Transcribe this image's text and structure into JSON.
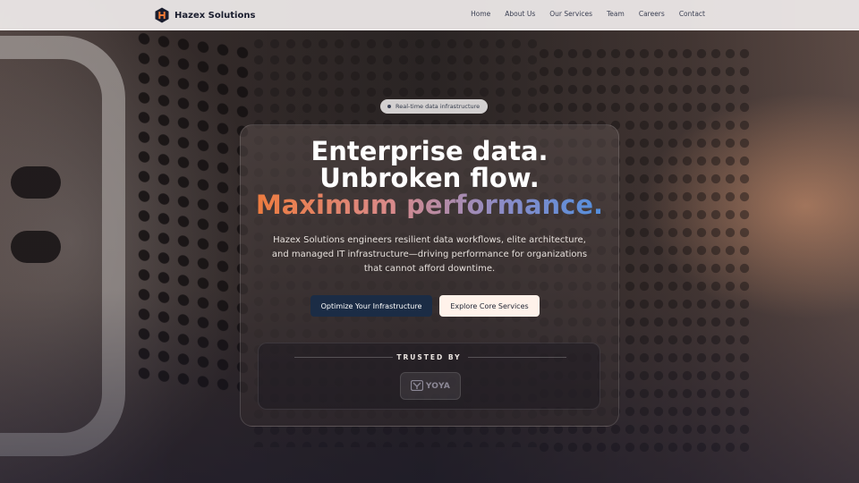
{
  "brand": {
    "name": "Hazex Solutions",
    "logo_icon": "hexagon-h-logo-icon"
  },
  "nav": {
    "links": [
      "Home",
      "About Us",
      "Our Services",
      "Team",
      "Careers",
      "Contact"
    ]
  },
  "hero": {
    "badge": "Real-time data infrastructure",
    "headline_line1": "Enterprise data.",
    "headline_line2": "Unbroken flow.",
    "headline_line3": "Maximum performance.",
    "subtext": "Hazex Solutions engineers resilient data workflows, elite architecture, and managed IT infrastructure—driving performance for organizations that cannot afford downtime.",
    "primary_cta": "Optimize Your Infrastructure",
    "secondary_cta": "Explore Core Services"
  },
  "trusted": {
    "label": "TRUSTED BY",
    "partners": [
      {
        "name": "YOYA",
        "logo_icon": "yoya-logo-icon"
      }
    ]
  },
  "colors": {
    "accent_gradient": [
      "#f07a36",
      "#d98a8a",
      "#8a8cc8",
      "#4a8fe0"
    ],
    "primary_button": "#1b2c45",
    "secondary_button": "#fff2ea",
    "navbar_bg": "#f0ecec"
  }
}
